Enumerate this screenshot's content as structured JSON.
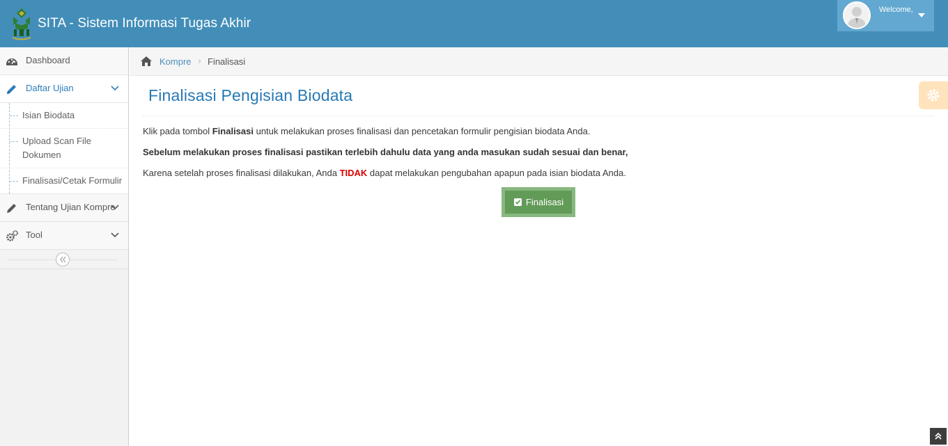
{
  "app": {
    "title": "SITA - Sistem Informasi Tugas Akhir"
  },
  "user": {
    "welcome": "Welcome,"
  },
  "sidebar": {
    "items": [
      {
        "label": "Dashboard",
        "icon": "tachometer-icon"
      },
      {
        "label": "Daftar Ujian",
        "icon": "pencil-icon",
        "active": true
      },
      {
        "label": "Tentang Ujian Kompre",
        "icon": "pencil-icon"
      },
      {
        "label": "Tool",
        "icon": "cogs-icon"
      }
    ],
    "submenu": [
      {
        "label": "Isian Biodata"
      },
      {
        "label": "Upload Scan File Dokumen"
      },
      {
        "label": "Finalisasi/Cetak Formulir"
      }
    ]
  },
  "breadcrumb": {
    "parent": "Kompre",
    "separator": "›",
    "current": "Finalisasi"
  },
  "main": {
    "title": "Finalisasi Pengisian Biodata",
    "p1_before": "Klik pada tombol ",
    "p1_bold": "Finalisasi",
    "p1_after": " untuk melakukan proses finalisasi dan pencetakan formulir pengisian biodata Anda.",
    "p2": "Sebelum melakukan proses finalisasi pastikan terlebih dahulu data yang anda masukan sudah sesuai dan benar,",
    "p3_before": "Karena setelah proses finalisasi dilakukan, Anda ",
    "p3_danger": "TIDAK",
    "p3_after": " dapat melakukan pengubahan apapun pada isian biodata Anda.",
    "button_label": "Finalisasi"
  },
  "colors": {
    "navbar": "#438eb9",
    "title": "#2679b5",
    "success": "#629b58",
    "danger": "#dd0000"
  }
}
